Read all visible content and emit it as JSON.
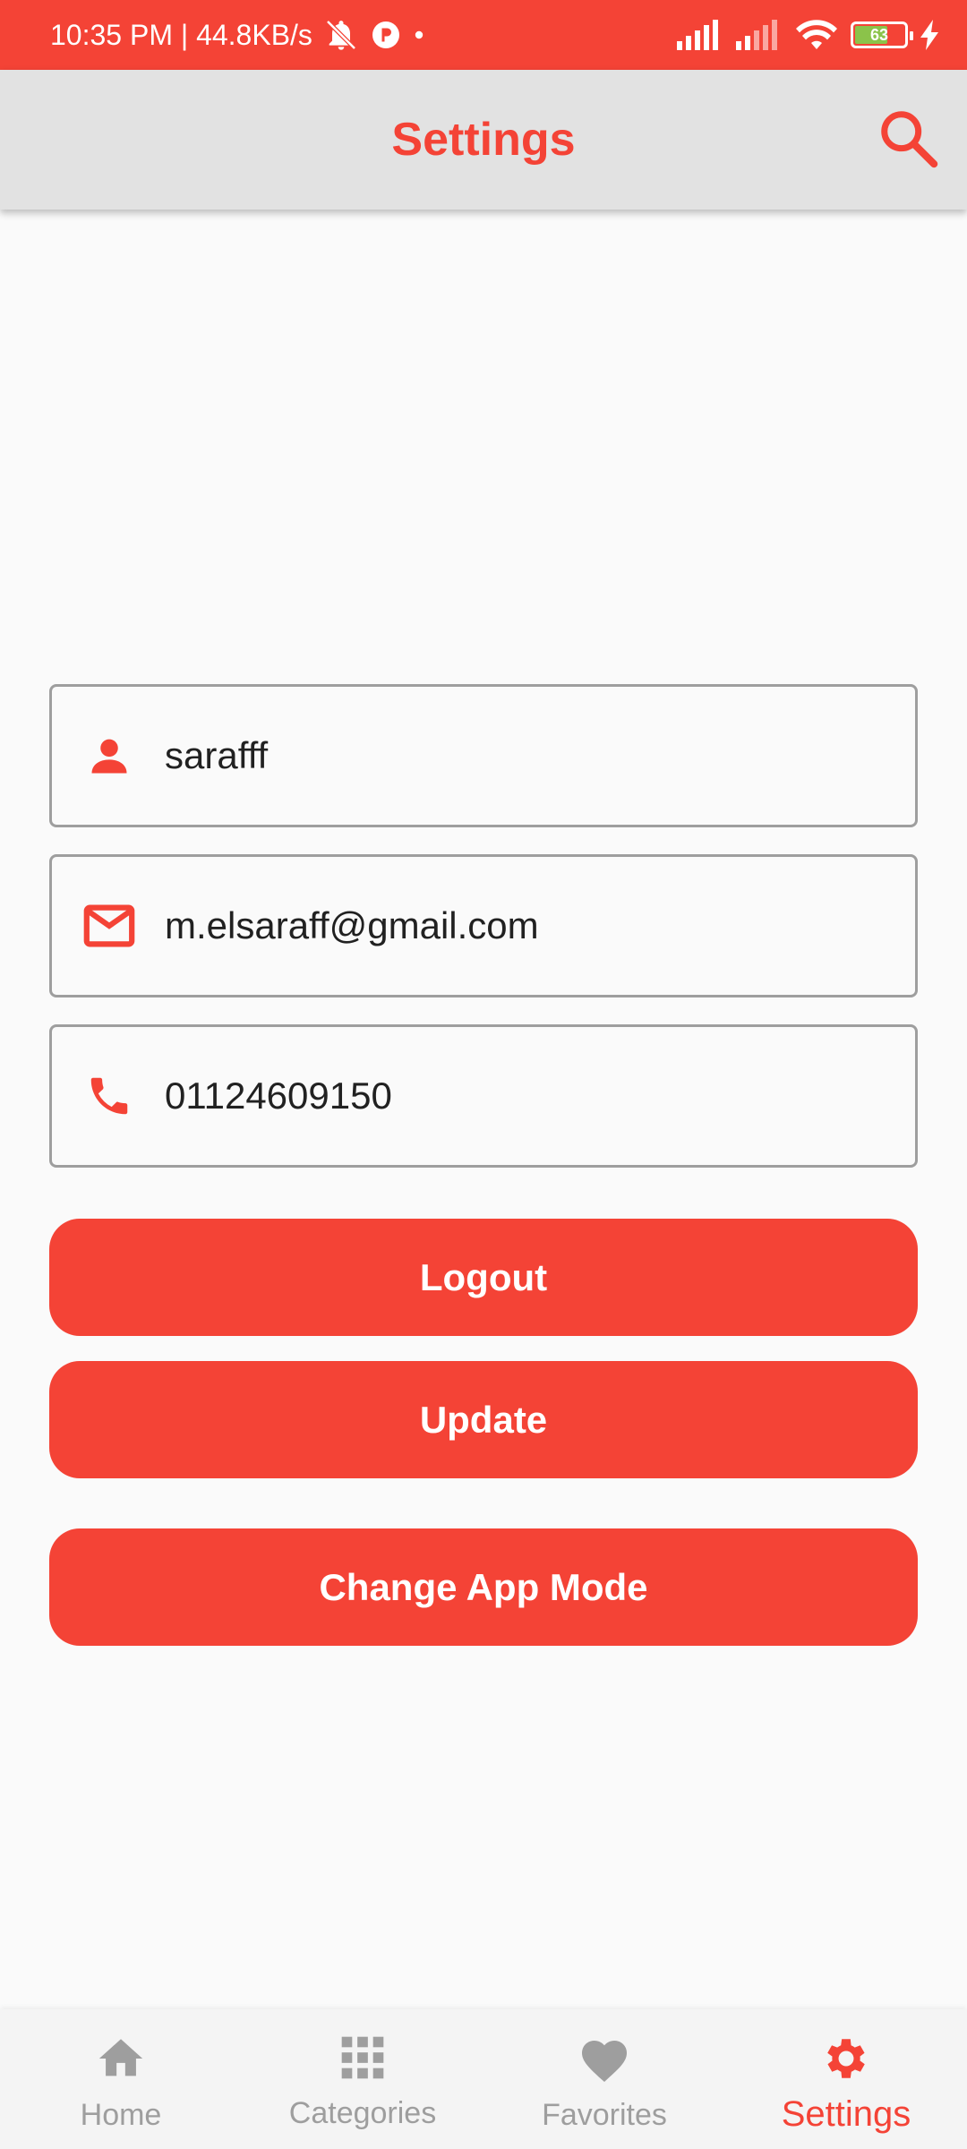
{
  "status_bar": {
    "time_speed": "10:35 PM | 44.8KB/s",
    "battery": "63"
  },
  "app_bar": {
    "title": "Settings"
  },
  "profile": {
    "username": "sarafff",
    "email": "m.elsaraff@gmail.com",
    "phone": "01124609150"
  },
  "buttons": {
    "logout": "Logout",
    "update": "Update",
    "change_mode": "Change App Mode"
  },
  "bottom_nav": {
    "items": [
      {
        "label": "Home",
        "icon": "home-icon",
        "active": false
      },
      {
        "label": "Categories",
        "icon": "apps-grid-icon",
        "active": false
      },
      {
        "label": "Favorites",
        "icon": "heart-icon",
        "active": false
      },
      {
        "label": "Settings",
        "icon": "gear-icon",
        "active": true
      }
    ]
  },
  "colors": {
    "accent": "#f44336",
    "app_bar_bg": "#e2e2e2",
    "inactive": "#9e9e9e"
  }
}
